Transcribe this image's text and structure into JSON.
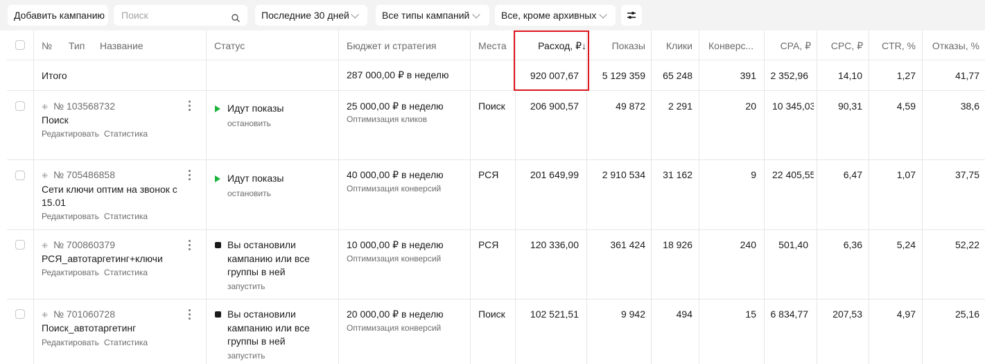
{
  "toolbar": {
    "add_campaign": "Добавить кампанию",
    "search_placeholder": "Поиск",
    "period": "Последние 30 дней",
    "campaign_types": "Все типы кампаний",
    "archive_filter": "Все, кроме архивных"
  },
  "columns": {
    "num": "№",
    "type": "Тип",
    "name": "Название",
    "status": "Статус",
    "budget": "Бюджет и стратегия",
    "places": "Места",
    "spend": "Расход, ₽↓",
    "impressions": "Показы",
    "clicks": "Клики",
    "conversions": "Конверс...",
    "cpa": "CPA, ₽",
    "cpc": "CPC, ₽",
    "ctr": "CTR, %",
    "bounces": "Отказы, %"
  },
  "total": {
    "label": "Итого",
    "budget": "287 000,00 ₽ в неделю",
    "spend": "920 007,67",
    "impressions": "5 129 359",
    "clicks": "65 248",
    "conversions": "391",
    "cpa": "2 352,96",
    "cpc": "14,10",
    "ctr": "1,27",
    "bounces": "41,77"
  },
  "rows": [
    {
      "id": "№ 103568732",
      "name": "Поиск",
      "edit": "Редактировать",
      "stats": "Статистика",
      "status": "Идут показы",
      "status_action": "остановить",
      "budget": "25 000,00 ₽ в неделю",
      "strategy": "Оптимизация кликов",
      "places": "Поиск",
      "spend": "206 900,57",
      "impressions": "49 872",
      "clicks": "2 291",
      "conversions": "20",
      "cpa": "10 345,03",
      "cpc": "90,31",
      "ctr": "4,59",
      "bounces": "38,6"
    },
    {
      "id": "№ 705486858",
      "name": "Сети ключи оптим на звонок с 15.01",
      "edit": "Редактировать",
      "stats": "Статистика",
      "status": "Идут показы",
      "status_action": "остановить",
      "budget": "40 000,00 ₽ в неделю",
      "strategy": "Оптимизация конверсий",
      "places": "РСЯ",
      "spend": "201 649,99",
      "impressions": "2 910 534",
      "clicks": "31 162",
      "conversions": "9",
      "cpa": "22 405,55",
      "cpc": "6,47",
      "ctr": "1,07",
      "bounces": "37,75"
    },
    {
      "id": "№ 700860379",
      "name": "РСЯ_автотаргетинг+ключи",
      "edit": "Редактировать",
      "stats": "Статистика",
      "status": "Вы остановили кампанию или все группы в ней",
      "status_action": "запустить",
      "budget": "10 000,00 ₽ в неделю",
      "strategy": "Оптимизация конверсий",
      "places": "РСЯ",
      "spend": "120 336,00",
      "impressions": "361 424",
      "clicks": "18 926",
      "conversions": "240",
      "cpa": "501,40",
      "cpc": "6,36",
      "ctr": "5,24",
      "bounces": "52,22"
    },
    {
      "id": "№ 701060728",
      "name": "Поиск_автотаргетинг",
      "edit": "Редактировать",
      "stats": "Статистика",
      "status": "Вы остановили кампанию или все группы в ней",
      "status_action": "запустить",
      "budget": "20 000,00 ₽ в неделю",
      "strategy": "Оптимизация конверсий",
      "places": "Поиск",
      "spend": "102 521,51",
      "impressions": "9 942",
      "clicks": "494",
      "conversions": "15",
      "cpa": "6 834,77",
      "cpc": "207,53",
      "ctr": "4,97",
      "bounces": "25,16"
    }
  ],
  "colors": {
    "highlight": "#e0141e",
    "status_running": "#1bb33b",
    "status_stopped": "#1a1a1a"
  }
}
